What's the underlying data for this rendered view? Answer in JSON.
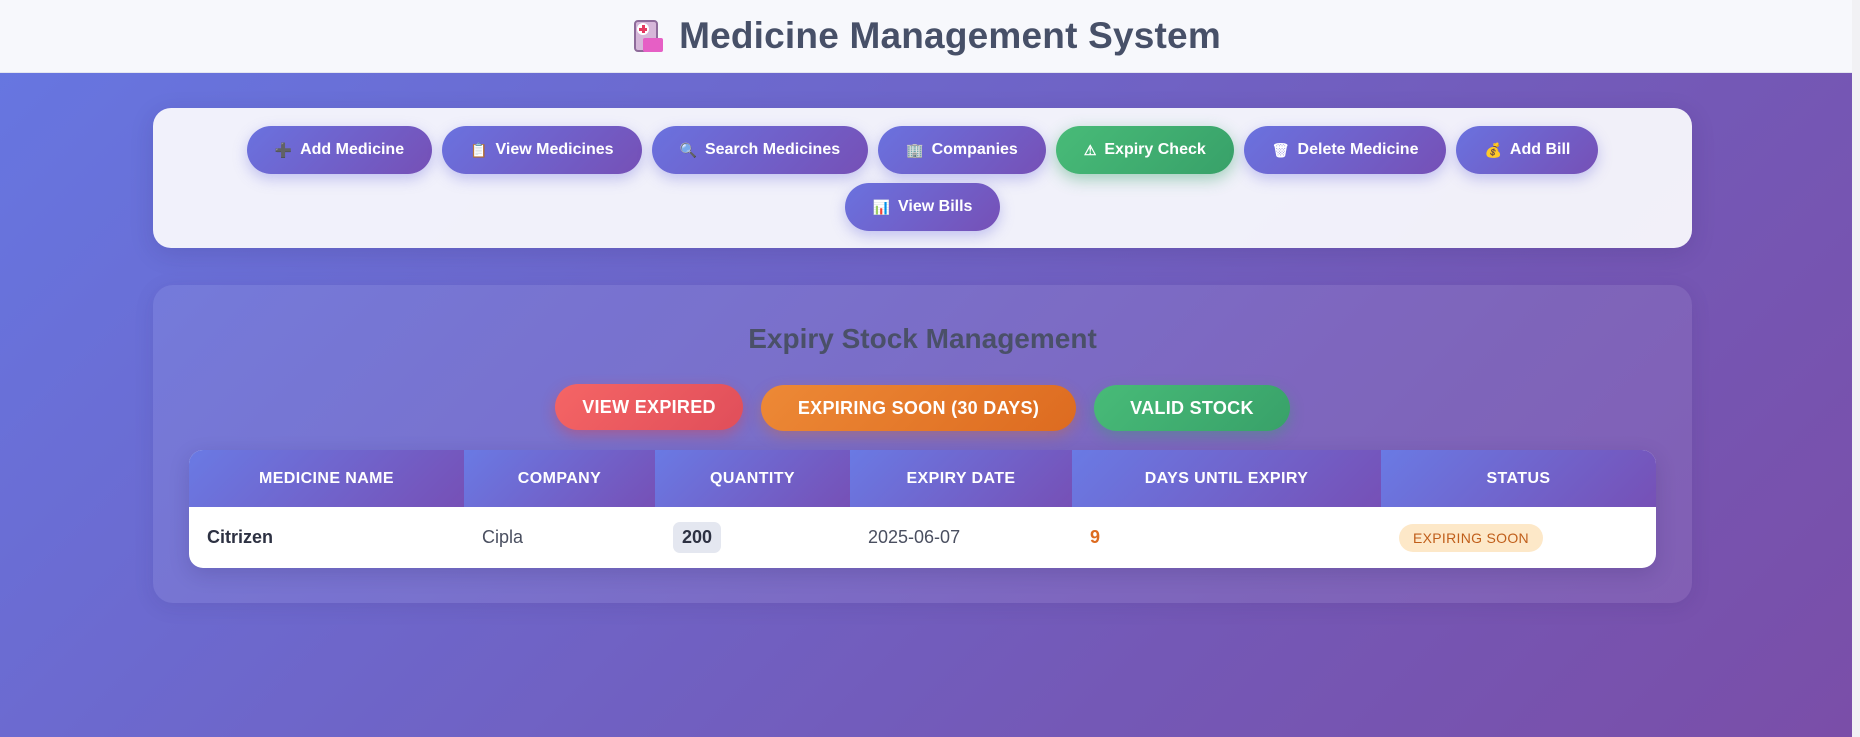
{
  "app": {
    "title": "Medicine Management System",
    "title_icon": "hospital-icon"
  },
  "nav": {
    "buttons": [
      {
        "label": "Add Medicine",
        "icon": "plus-icon",
        "glyph": "➕",
        "active": false
      },
      {
        "label": "View Medicines",
        "icon": "clipboard-icon",
        "glyph": "📋",
        "active": false
      },
      {
        "label": "Search Medicines",
        "icon": "magnifier-icon",
        "glyph": "🔍",
        "active": false
      },
      {
        "label": "Companies",
        "icon": "building-icon",
        "glyph": "🏢",
        "active": false
      },
      {
        "label": "Expiry Check",
        "icon": "warning-icon",
        "glyph": "⚠",
        "active": true
      },
      {
        "label": "Delete Medicine",
        "icon": "trash-icon",
        "glyph": "🗑",
        "active": false
      },
      {
        "label": "Add Bill",
        "icon": "money-bag-icon",
        "glyph": "💰",
        "active": false
      },
      {
        "label": "View Bills",
        "icon": "bar-chart-icon",
        "glyph": "📊",
        "active": false
      }
    ]
  },
  "expiry": {
    "heading": "Expiry Stock Management",
    "filters": {
      "expired": "VIEW EXPIRED",
      "soon": "EXPIRING SOON (30 DAYS)",
      "valid": "VALID STOCK"
    },
    "table": {
      "headers": [
        "MEDICINE NAME",
        "COMPANY",
        "QUANTITY",
        "EXPIRY DATE",
        "DAYS UNTIL EXPIRY",
        "STATUS"
      ],
      "rows": [
        {
          "name": "Citrizen",
          "company": "Cipla",
          "quantity": "200",
          "expiry_date": "2025-06-07",
          "days": "9",
          "status": "EXPIRING SOON"
        }
      ]
    }
  },
  "colors": {
    "accent": "#6a72df",
    "active": "#38a169",
    "expired": "#f56565",
    "soon": "#dd6b20",
    "valid": "#48bb78"
  }
}
